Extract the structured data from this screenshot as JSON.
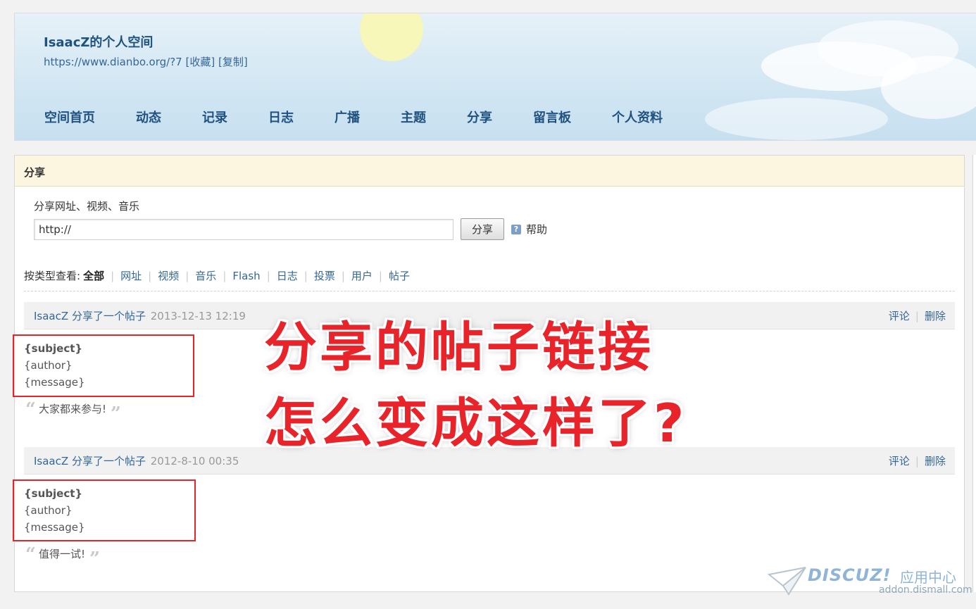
{
  "header": {
    "title": "IsaacZ的个人空间",
    "url": "https://www.dianbo.org/?7",
    "bookmark": "[收藏]",
    "copy": "[复制]"
  },
  "nav": [
    "空间首页",
    "动态",
    "记录",
    "日志",
    "广播",
    "主题",
    "分享",
    "留言板",
    "个人资料"
  ],
  "section": {
    "title": "分享",
    "share_label": "分享网址、视频、音乐",
    "input_value": "http://",
    "share_button": "分享",
    "help": "帮助"
  },
  "filter": {
    "prefix": "按类型查看:",
    "current": "全部",
    "items": [
      "网址",
      "视频",
      "音乐",
      "Flash",
      "日志",
      "投票",
      "用户",
      "帖子"
    ]
  },
  "feed": [
    {
      "user": "IsaacZ",
      "action": "分享了一个帖子",
      "time": "2013-12-13 12:19",
      "comment": "评论",
      "delete": "删除",
      "subject": "{subject}",
      "author": "{author}",
      "message": "{message}",
      "quote": "大家都来参与!"
    },
    {
      "user": "IsaacZ",
      "action": "分享了一个帖子",
      "time": "2012-8-10 00:35",
      "comment": "评论",
      "delete": "删除",
      "subject": "{subject}",
      "author": "{author}",
      "message": "{message}",
      "quote": "值得一试!"
    }
  ],
  "overlay": {
    "line1": "分享的帖子链接",
    "line2": "怎么变成这样了?"
  },
  "watermark": {
    "brand": "DISCUZ!",
    "cn": "应用中心",
    "url": "addon.dismall.com"
  },
  "colors": {
    "link": "#336699",
    "nav": "#1f5280",
    "highlight_red": "#e8232a",
    "panel_head": "#fcf5e0"
  }
}
